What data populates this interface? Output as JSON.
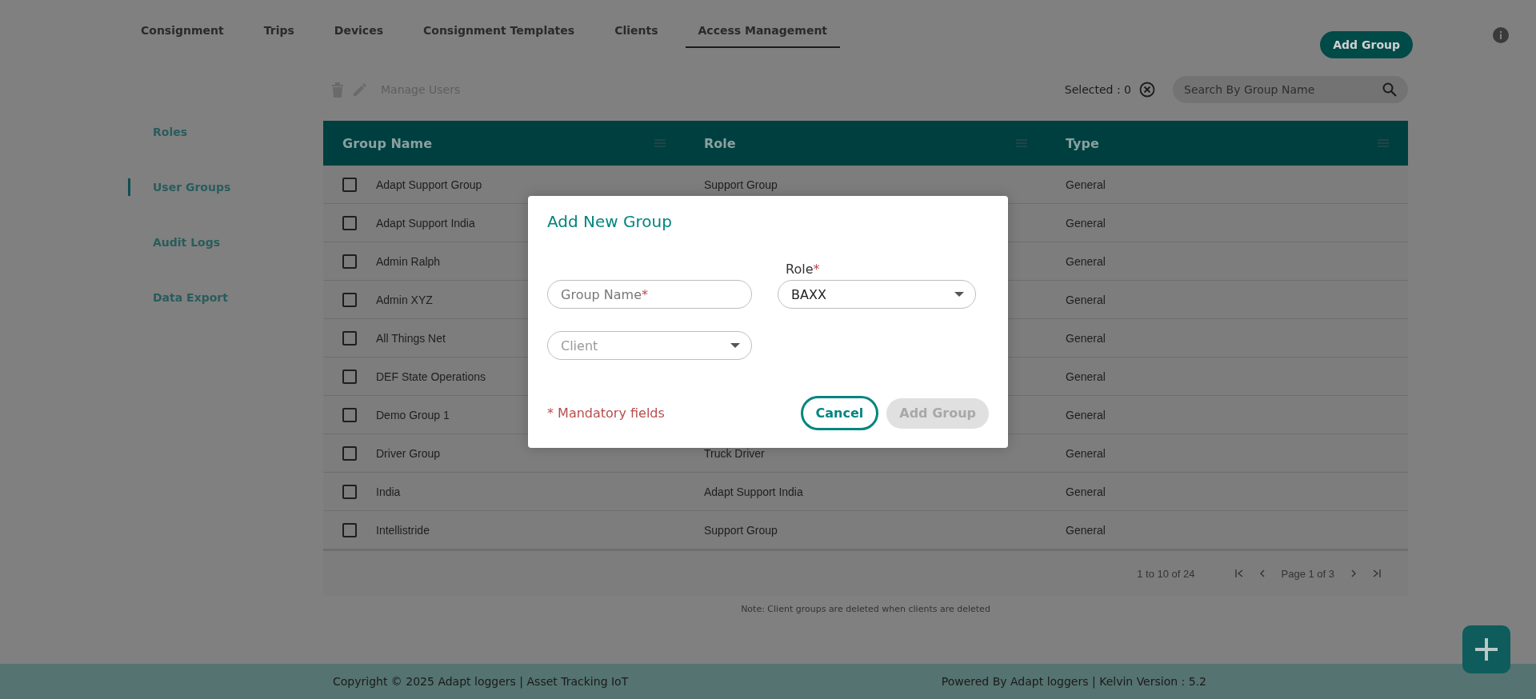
{
  "nav_tabs": [
    {
      "label": "Consignment",
      "selected": false
    },
    {
      "label": "Trips",
      "selected": false
    },
    {
      "label": "Devices",
      "selected": false
    },
    {
      "label": "Consignment Templates",
      "selected": false
    },
    {
      "label": "Clients",
      "selected": false
    },
    {
      "label": "Access Management",
      "selected": true
    }
  ],
  "add_group_button": "Add Group",
  "sidebar": {
    "items": [
      {
        "label": "Roles",
        "selected": false
      },
      {
        "label": "User Groups",
        "selected": true
      },
      {
        "label": "Audit Logs",
        "selected": false
      },
      {
        "label": "Data Export",
        "selected": false
      }
    ]
  },
  "toolbar": {
    "manage_users": "Manage Users",
    "selected_count": "Selected : 0",
    "search": {
      "placeholder": "Search By Group Name"
    }
  },
  "table": {
    "columns": [
      "Group Name",
      "Role",
      "Type"
    ],
    "rows": [
      {
        "group_name": "Adapt Support Group",
        "role": "Support Group",
        "type": "General",
        "checked": false
      },
      {
        "group_name": "Adapt Support India",
        "role": "",
        "type": "General",
        "checked": false
      },
      {
        "group_name": "Admin Ralph",
        "role": "",
        "type": "General",
        "checked": false
      },
      {
        "group_name": "Admin XYZ",
        "role": "",
        "type": "General",
        "checked": false
      },
      {
        "group_name": "All Things Net",
        "role": "",
        "type": "General",
        "checked": false
      },
      {
        "group_name": "DEF State Operations",
        "role": "",
        "type": "General",
        "checked": false
      },
      {
        "group_name": "Demo Group 1",
        "role": "",
        "type": "General",
        "checked": false
      },
      {
        "group_name": "Driver Group",
        "role": "Truck Driver",
        "type": "General",
        "checked": false
      },
      {
        "group_name": "India",
        "role": "Adapt Support India",
        "type": "General",
        "checked": false
      },
      {
        "group_name": "Intellistride",
        "role": "Support Group",
        "type": "General",
        "checked": false
      }
    ],
    "pager": {
      "range": "1 to 10 of 24",
      "page": "Page 1 of 3"
    }
  },
  "note": "Note: Client groups are deleted when clients are deleted",
  "footer": {
    "copyright": "Copyright © 2025 Adapt loggers | Asset Tracking IoT",
    "powered": "Powered By Adapt loggers | Kelvin Version : 5.2"
  },
  "dialog": {
    "title": "Add New Group",
    "group_name": {
      "placeholder": "Group Name",
      "required_mark": "*"
    },
    "role": {
      "label": "Role",
      "required_mark": "*",
      "value": "BAXX"
    },
    "client": {
      "placeholder": "Client"
    },
    "mandatory_note": "* Mandatory fields",
    "cancel_button": "Cancel",
    "add_button": {
      "label": "Add Group",
      "disabled": true
    }
  }
}
